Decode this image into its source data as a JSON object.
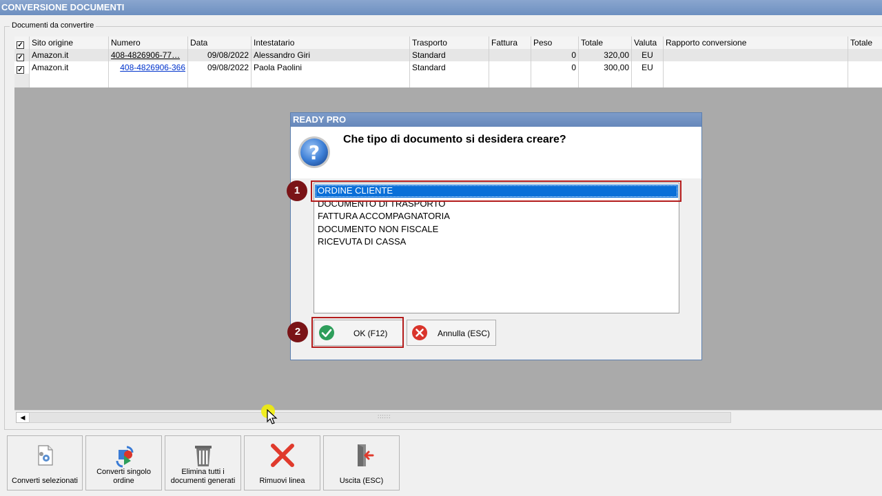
{
  "window": {
    "title": "CONVERSIONE DOCUMENTI"
  },
  "group": {
    "label": "Documenti da convertire"
  },
  "grid": {
    "headers": [
      "Sito origine",
      "Numero",
      "Data",
      "Intestatario",
      "Trasporto",
      "Fattura",
      "Peso",
      "Totale",
      "Valuta",
      "Rapporto conversione",
      "Totale"
    ],
    "rows": [
      {
        "checked": true,
        "sito": "Amazon.it",
        "numero": "408-4826906-77…",
        "data": "09/08/2022",
        "intestatario": "Alessandro Giri",
        "trasporto": "Standard",
        "fattura": "",
        "peso": "0",
        "totale": "320,00",
        "valuta": "EU",
        "rapporto": ""
      },
      {
        "checked": true,
        "sito": "Amazon.it",
        "numero": "408-4826906-366",
        "data": "09/08/2022",
        "intestatario": "Paola Paolini",
        "trasporto": "Standard",
        "fattura": "",
        "peso": "0",
        "totale": "300,00",
        "valuta": "EU",
        "rapporto": ""
      }
    ]
  },
  "dialog": {
    "title": "READY PRO",
    "question": "Che tipo di documento si desidera creare?",
    "options": [
      "ORDINE CLIENTE",
      "DOCUMENTO DI TRASPORTO",
      "FATTURA ACCOMPAGNATORIA",
      "DOCUMENTO NON FISCALE",
      "RICEVUTA DI CASSA"
    ],
    "selected": "ORDINE CLIENTE",
    "ok_label": "OK (F12)",
    "cancel_label": "Annulla (ESC)"
  },
  "markers": [
    "1",
    "2"
  ],
  "toolbar": {
    "convert_selected": "Converti selezionati",
    "convert_single": "Converti singolo ordine",
    "delete_all": "Elimina tutti i documenti generati",
    "remove_line": "Rimuovi linea",
    "exit": "Uscita (ESC)"
  },
  "colors": {
    "highlight": "#b31b1b",
    "selection": "#0a6fd8",
    "marker": "#7a1417",
    "titlebar": "#6d8fc0"
  }
}
